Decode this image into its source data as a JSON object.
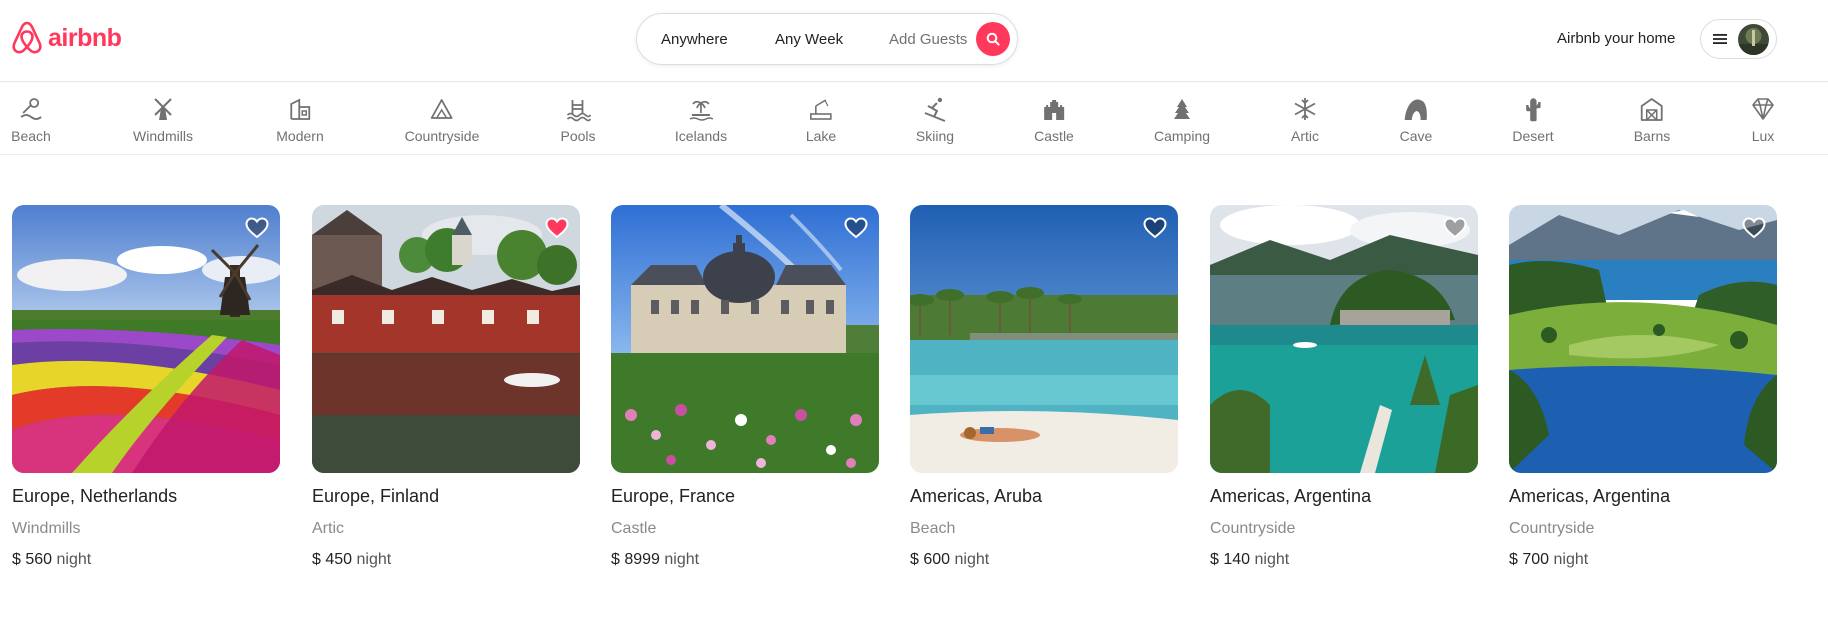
{
  "brand": {
    "name": "airbnb",
    "color": "#ff385c"
  },
  "search": {
    "anywhere": "Anywhere",
    "any_week": "Any Week",
    "add_guests": "Add Guests",
    "icon": "search-icon"
  },
  "header": {
    "host_link": "Airbnb your home",
    "menu_icon": "hamburger-icon"
  },
  "categories": [
    {
      "label": "Beach",
      "icon": "beach-icon"
    },
    {
      "label": "Windmills",
      "icon": "windmill-icon"
    },
    {
      "label": "Modern",
      "icon": "modern-house-icon"
    },
    {
      "label": "Countryside",
      "icon": "mountain-icon"
    },
    {
      "label": "Pools",
      "icon": "pool-icon"
    },
    {
      "label": "Icelands",
      "icon": "island-icon"
    },
    {
      "label": "Lake",
      "icon": "lake-icon"
    },
    {
      "label": "Skiing",
      "icon": "skiing-icon"
    },
    {
      "label": "Castle",
      "icon": "castle-icon"
    },
    {
      "label": "Camping",
      "icon": "camping-icon"
    },
    {
      "label": "Artic",
      "icon": "snowflake-icon"
    },
    {
      "label": "Cave",
      "icon": "cave-icon"
    },
    {
      "label": "Desert",
      "icon": "cactus-icon"
    },
    {
      "label": "Barns",
      "icon": "barn-icon"
    },
    {
      "label": "Lux",
      "icon": "diamond-icon"
    }
  ],
  "listings": [
    {
      "location": "Europe, Netherlands",
      "category": "Windmills",
      "price": "$ 560",
      "unit": "night",
      "favorited": false
    },
    {
      "location": "Europe, Finland",
      "category": "Artic",
      "price": "$ 450",
      "unit": "night",
      "favorited": true
    },
    {
      "location": "Europe, France",
      "category": "Castle",
      "price": "$ 8999",
      "unit": "night",
      "favorited": false
    },
    {
      "location": "Americas, Aruba",
      "category": "Beach",
      "price": "$ 600",
      "unit": "night",
      "favorited": false
    },
    {
      "location": "Americas, Argentina",
      "category": "Countryside",
      "price": "$ 140",
      "unit": "night",
      "favorited": false
    },
    {
      "location": "Americas, Argentina",
      "category": "Countryside",
      "price": "$ 700",
      "unit": "night",
      "favorited": false
    }
  ],
  "colors": {
    "heart_active": "#ff385c",
    "heart_inactive": "#ffffff"
  }
}
